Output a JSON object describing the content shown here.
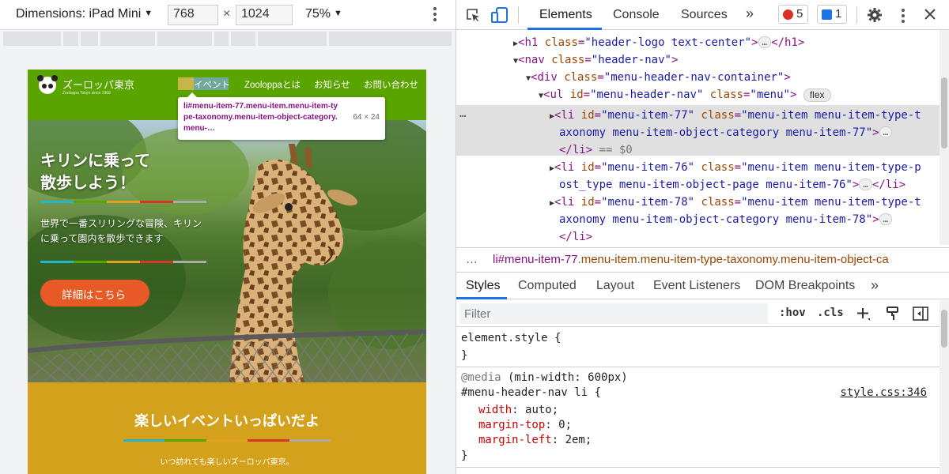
{
  "device_toolbar": {
    "device": "Dimensions: iPad Mini",
    "width": "768",
    "height": "1024",
    "times": "×",
    "zoom": "75%"
  },
  "site": {
    "logo_title": "ズーロッパ東京",
    "logo_sub": "Zooloppa Tokyo since 1969",
    "nav": [
      "イベント",
      "Zoolоppaとは",
      "お知らせ",
      "お問い合わせ"
    ],
    "hero_title_1": "キリンに乗って",
    "hero_title_2": "散歩しよう！",
    "hero_text_1": "世界で一番スリリングな冒険、キリン",
    "hero_text_2": "に乗って園内を散歩できます",
    "cta": "詳細はこちら",
    "band_title": "楽しいイベントいっぱいだよ",
    "band_text": "いつ訪れても楽しいズーロッパ東京。",
    "stripe_colors": [
      "#25b5c9",
      "#5aa400",
      "#e0a020",
      "#d8342a",
      "#aaaaaa"
    ]
  },
  "inspect_tooltip": {
    "selector": "li#menu-item-77.menu-item.menu-item-type-taxonomy.menu-item-object-category.menu-…",
    "size": "64 × 24"
  },
  "devtools": {
    "tabs": [
      "Elements",
      "Console",
      "Sources"
    ],
    "more_tabs": "»",
    "errors": "5",
    "messages": "1",
    "tree": {
      "l1_tag_open": "<h1",
      "l1_attr": "class",
      "l1_val": "\"header-logo text-center\"",
      "l1_close": "</h1>",
      "l2_tag": "<nav",
      "l2_attr": "class",
      "l2_val": "\"header-nav\"",
      "l3_tag": "<div",
      "l3_attr": "class",
      "l3_val": "\"menu-header-nav-container\"",
      "l4_tag": "<ul",
      "l4_attr1": "id",
      "l4_val1": "\"menu-header-nav\"",
      "l4_attr2": "class",
      "l4_val2": "\"menu\"",
      "l4_badge": "flex",
      "li77_a": "<li",
      "li77_id": "\"menu-item-77\"",
      "li77_class_1": "\"menu-item menu-item-type-t",
      "li77_class_2": "axonomy menu-item-object-category menu-item-77\"",
      "li77_end": "</li>",
      "li77_ref": "== $0",
      "li76_id": "\"menu-item-76\"",
      "li76_class_1": "\"menu-item menu-item-type-p",
      "li76_class_2": "ost_type menu-item-object-page menu-item-76\"",
      "li78_id": "\"menu-item-78\"",
      "li78_class_1": "\"menu-item menu-item-type-t",
      "li78_class_2": "axonomy menu-item-object-category menu-item-78\"",
      "ellipsis": "…"
    },
    "breadcrumb": {
      "dots": "…",
      "tag": "li#menu-item-77",
      "classes": ".menu-item.menu-item-type-taxonomy.menu-item-object-ca"
    },
    "sub_tabs": [
      "Styles",
      "Computed",
      "Layout",
      "Event Listeners",
      "DOM Breakpoints"
    ],
    "sub_more": "»",
    "filter_placeholder": "Filter",
    "hov": ":hov",
    "cls": ".cls",
    "styles": {
      "element_style": "element.style {",
      "close": "}",
      "media_kw": "@media",
      "media_q": " (min-width: 600px)",
      "selector": "#menu-header-nav li {",
      "source": "style.css:346",
      "props": [
        {
          "name": "width",
          "value": "auto;"
        },
        {
          "name": "margin-top",
          "value": "0;"
        },
        {
          "name": "margin-left",
          "value": "2em;"
        }
      ]
    }
  }
}
